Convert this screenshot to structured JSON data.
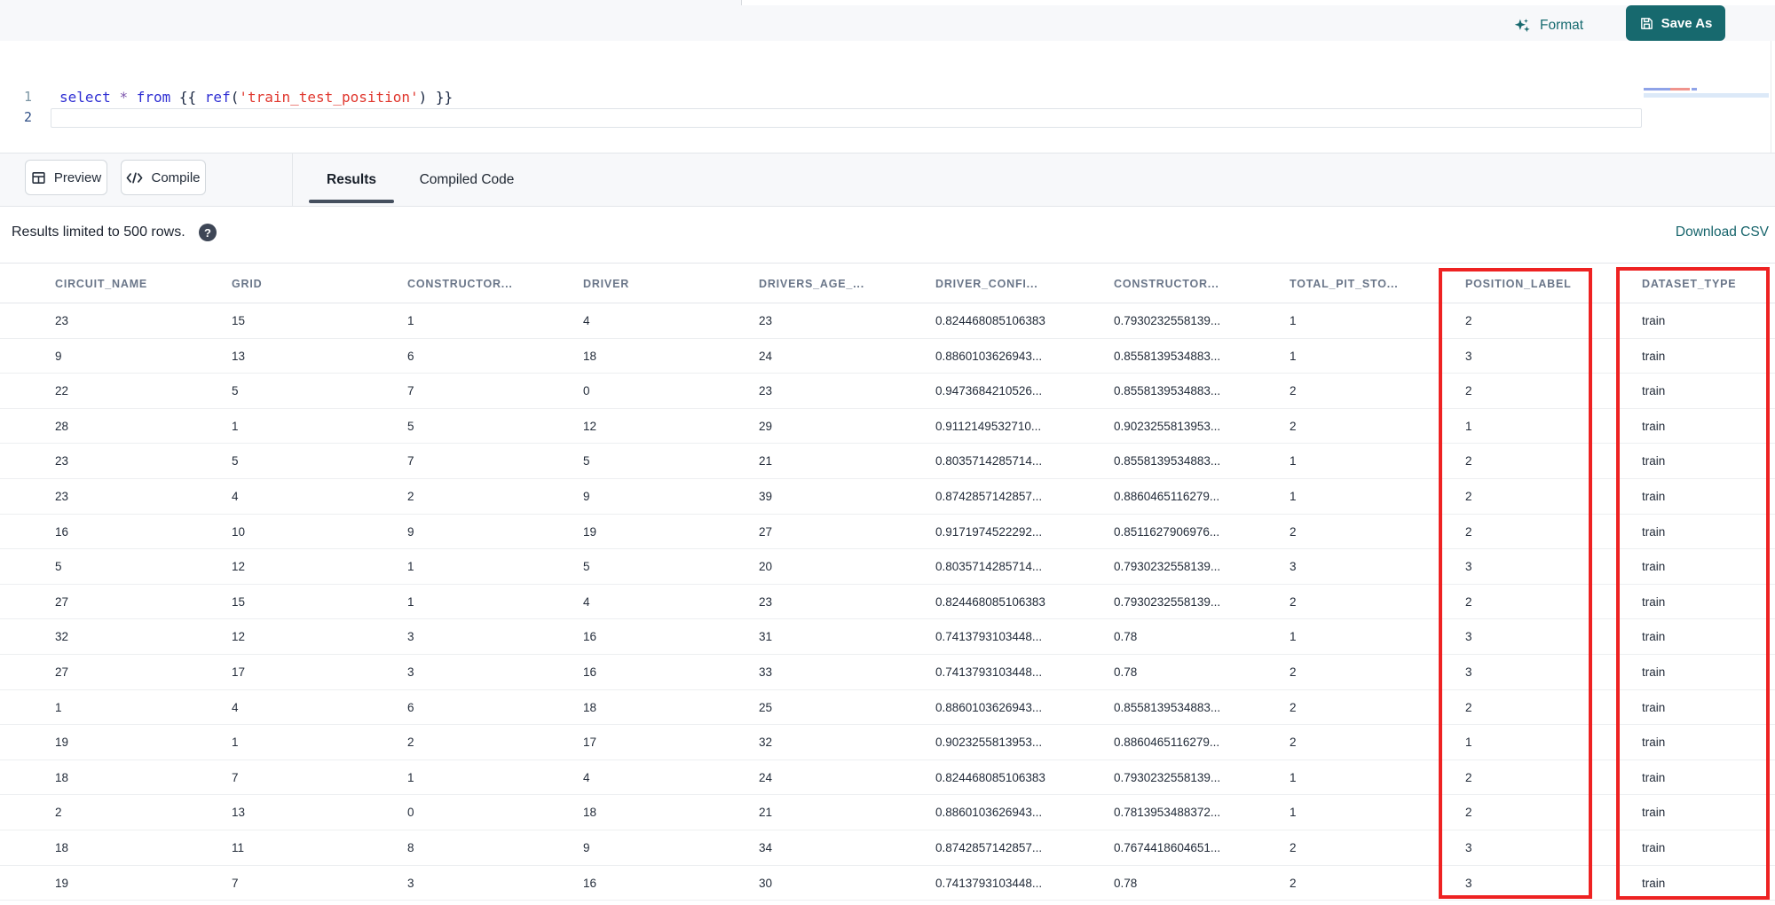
{
  "editor": {
    "header": {
      "format_label": "Format",
      "save_as_label": "Save As"
    },
    "gutter": {
      "line1": "1",
      "line2": "2"
    },
    "code_tokens": [
      {
        "text": "select",
        "type": "keyword"
      },
      {
        "text": " ",
        "type": "plain"
      },
      {
        "text": "*",
        "type": "operator"
      },
      {
        "text": " ",
        "type": "plain"
      },
      {
        "text": "from",
        "type": "keyword"
      },
      {
        "text": " ",
        "type": "plain"
      },
      {
        "text": "{{ ",
        "type": "brace"
      },
      {
        "text": "ref",
        "type": "keyword"
      },
      {
        "text": "(",
        "type": "paren"
      },
      {
        "text": "'train_test_position'",
        "type": "string"
      },
      {
        "text": ")",
        "type": "paren"
      },
      {
        "text": " }}",
        "type": "brace"
      }
    ]
  },
  "toolbar": {
    "preview_label": "Preview",
    "compile_label": "Compile",
    "tabs": [
      {
        "label": "Results",
        "active": true
      },
      {
        "label": "Compiled Code",
        "active": false
      }
    ]
  },
  "results_bar": {
    "info_text": "Results limited to 500 rows.",
    "help_icon": "?",
    "download_label": "Download CSV"
  },
  "table": {
    "columns": [
      "CIRCUIT_NAME",
      "GRID",
      "CONSTRUCTOR...",
      "DRIVER",
      "DRIVERS_AGE_...",
      "DRIVER_CONFI...",
      "CONSTRUCTOR...",
      "TOTAL_PIT_STO...",
      "POSITION_LABEL",
      "DATASET_TYPE"
    ],
    "rows": [
      [
        "23",
        "15",
        "1",
        "4",
        "23",
        "0.824468085106383",
        "0.7930232558139...",
        "1",
        "2",
        "train"
      ],
      [
        "9",
        "13",
        "6",
        "18",
        "24",
        "0.8860103626943...",
        "0.8558139534883...",
        "1",
        "3",
        "train"
      ],
      [
        "22",
        "5",
        "7",
        "0",
        "23",
        "0.9473684210526...",
        "0.8558139534883...",
        "2",
        "2",
        "train"
      ],
      [
        "28",
        "1",
        "5",
        "12",
        "29",
        "0.9112149532710...",
        "0.9023255813953...",
        "2",
        "1",
        "train"
      ],
      [
        "23",
        "5",
        "7",
        "5",
        "21",
        "0.8035714285714...",
        "0.8558139534883...",
        "1",
        "2",
        "train"
      ],
      [
        "23",
        "4",
        "2",
        "9",
        "39",
        "0.8742857142857...",
        "0.8860465116279...",
        "1",
        "2",
        "train"
      ],
      [
        "16",
        "10",
        "9",
        "19",
        "27",
        "0.9171974522292...",
        "0.8511627906976...",
        "2",
        "2",
        "train"
      ],
      [
        "5",
        "12",
        "1",
        "5",
        "20",
        "0.8035714285714...",
        "0.7930232558139...",
        "3",
        "3",
        "train"
      ],
      [
        "27",
        "15",
        "1",
        "4",
        "23",
        "0.824468085106383",
        "0.7930232558139...",
        "2",
        "2",
        "train"
      ],
      [
        "32",
        "12",
        "3",
        "16",
        "31",
        "0.7413793103448...",
        "0.78",
        "1",
        "3",
        "train"
      ],
      [
        "27",
        "17",
        "3",
        "16",
        "33",
        "0.7413793103448...",
        "0.78",
        "2",
        "3",
        "train"
      ],
      [
        "1",
        "4",
        "6",
        "18",
        "25",
        "0.8860103626943...",
        "0.8558139534883...",
        "2",
        "2",
        "train"
      ],
      [
        "19",
        "1",
        "2",
        "17",
        "32",
        "0.9023255813953...",
        "0.8860465116279...",
        "2",
        "1",
        "train"
      ],
      [
        "18",
        "7",
        "1",
        "4",
        "24",
        "0.824468085106383",
        "0.7930232558139...",
        "1",
        "2",
        "train"
      ],
      [
        "2",
        "13",
        "0",
        "18",
        "21",
        "0.8860103626943...",
        "0.7813953488372...",
        "1",
        "2",
        "train"
      ],
      [
        "18",
        "11",
        "8",
        "9",
        "34",
        "0.8742857142857...",
        "0.7674418604651...",
        "2",
        "3",
        "train"
      ],
      [
        "19",
        "7",
        "3",
        "16",
        "30",
        "0.7413793103448...",
        "0.78",
        "2",
        "3",
        "train"
      ]
    ],
    "annotations": {
      "highlight_color": "#ee2222",
      "highlighted_columns": [
        "POSITION_LABEL",
        "DATASET_TYPE"
      ]
    }
  },
  "colors": {
    "accent_teal": "#17696e",
    "annotation_red": "#ee2222",
    "keyword_blue": "#2f2fd3",
    "string_red": "#e0372e"
  }
}
